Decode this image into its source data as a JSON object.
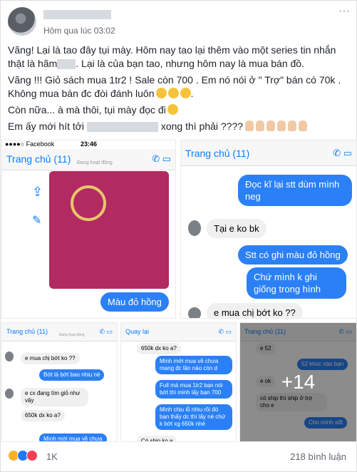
{
  "post": {
    "timestamp": "Hôm qua lúc 03:02",
    "lines": [
      "Vãng! Lại là tao đây tụi mày. Hôm nay tao lại thêm vào một series tin nhắn thật là hãm",
      ". Lại là của bạn tao, nhưng hôm nay là mua bán đồ.",
      "Vãng !!! Giỏ sách mua 1tr2 ! Sale còn 700 . Em nó nói ở \" Trợ\" bán có 70k . Không mua bán đc đòi đánh luôn",
      "Còn nữa... à mà thôi, tụi mày đọc đi",
      "Em ấy mới hít tởi",
      "xong thì phải ????"
    ]
  },
  "photo1": {
    "status_carrier": "●●●●○ Facebook",
    "status_time": "23:46",
    "back": "Trang chủ (11)",
    "sub": "Đang hoạt động",
    "msg": "Màu đỏ hồng"
  },
  "photo2": {
    "back": "Trang chủ (11)",
    "msgs": [
      "Đọc kĩ lại stt dùm mình neg",
      "Tại e ko bk",
      "Stt có ghi màu đỏ hồng",
      "Chứ mình k ghi giống trong hình",
      "e mua chị bớt ko ??"
    ]
  },
  "photo3": {
    "back": "Trang chủ (11)",
    "sub": "Đang hoạt động",
    "msgs": [
      "e mua chị bớt ko ??",
      "Bớt là bớt bao nhiu nè",
      "e cx đang tìm giỏ như vậy",
      "650k dx ko a?",
      "Mình mới mua về chưa"
    ]
  },
  "photo4": {
    "back": "Quay lại",
    "msgs": [
      "650k dx ko a?",
      "Minh mới mua về chưa mang đc lần nào còn d",
      "Full mà mua 1tr2 bạn nói bớt thì minh lấy bạn 700",
      "Minh chịu lỗ nhiu rồi đó bạn thấy dc thì lấy nè chứ k bớt xg 650k nhé",
      "Có ship ko ạ"
    ]
  },
  "photo5": {
    "back": "Trang chủ (11)",
    "msgs": [
      "e 52",
      "52 khúc nào bạn",
      "e ok",
      "có ship thì ship ở trợ cho e",
      "Cho mình sđt"
    ],
    "more": "+14"
  },
  "footer": {
    "reaction_count": "1K",
    "comments": "218 bình luận"
  },
  "colors": {
    "messenger_blue": "#2b80f5",
    "bag": "#b22a62"
  }
}
